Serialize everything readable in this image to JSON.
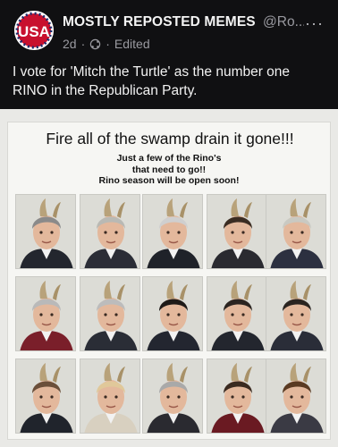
{
  "post": {
    "author": "MOSTLY REPOSTED MEMES",
    "handle": "@Ro...",
    "age": "2d",
    "separator": "·",
    "edited": "Edited",
    "more_icon": "···",
    "avatar_text": "USA",
    "text": "I vote for 'Mitch the Turtle' as the number one RINO in the Republican Party."
  },
  "meme": {
    "title": "Fire all of the swamp drain it gone!!!",
    "subtitle_lines": [
      "Just a few of the Rino's",
      "that need to go!!",
      "Rino season will be open soon!"
    ]
  },
  "colors": {
    "background": "#101012",
    "avatar_red": "#c8102e",
    "avatar_blue": "#1c2a6b",
    "horn": "#b8a27a"
  }
}
